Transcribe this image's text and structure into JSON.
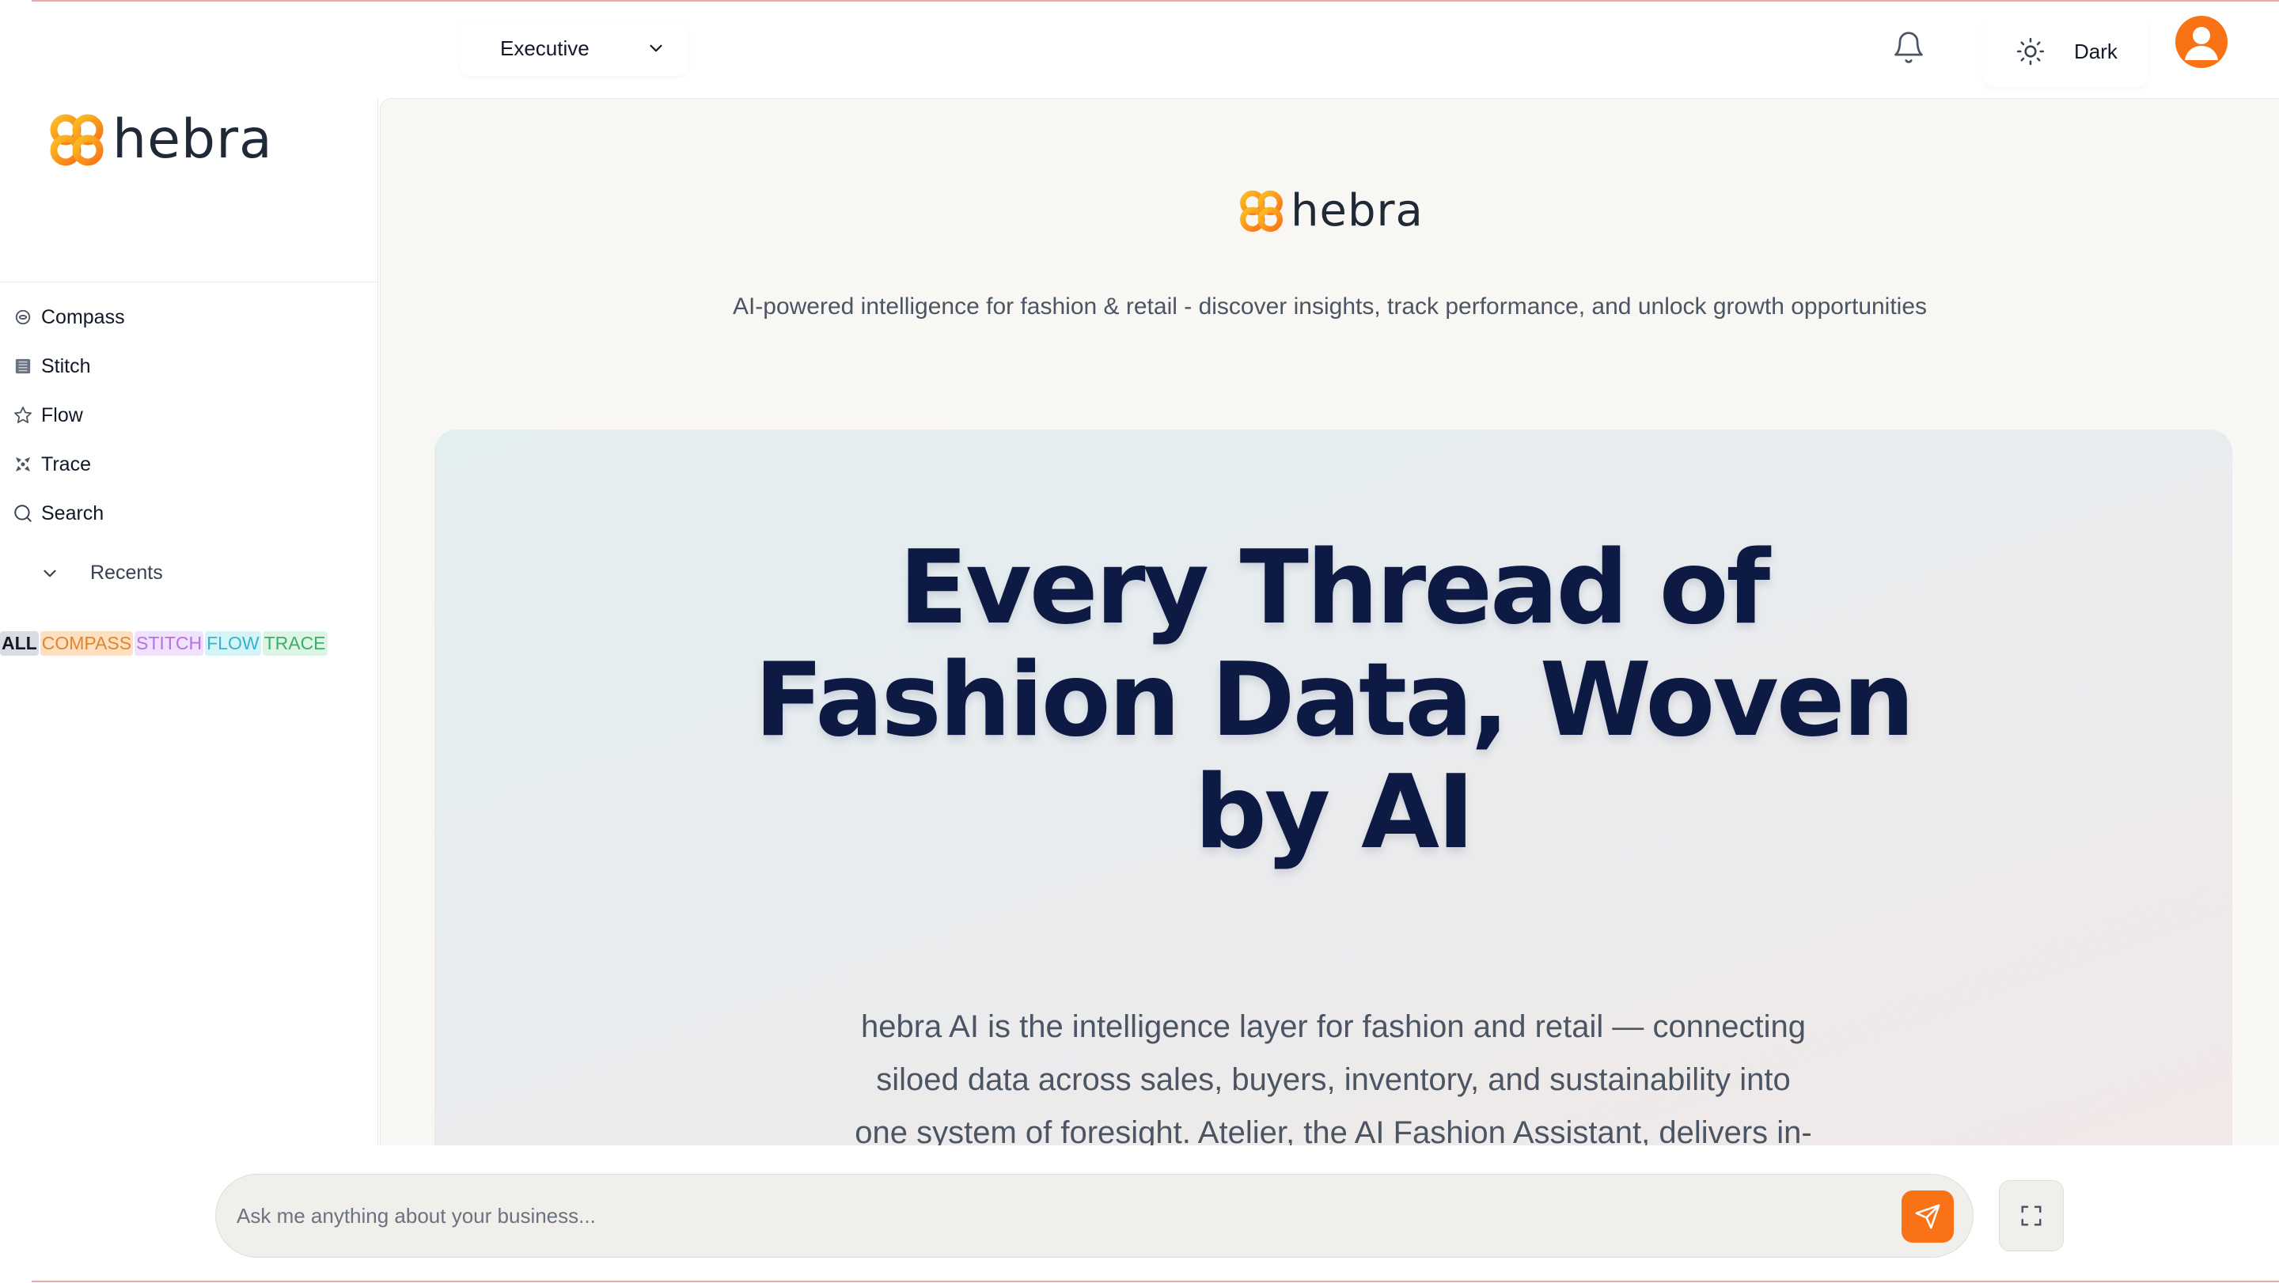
{
  "header": {
    "role_select": {
      "value": "Executive"
    },
    "theme_toggle_label": "Dark"
  },
  "brand": {
    "name": "hebra"
  },
  "sidebar": {
    "nav": [
      {
        "label": "Compass",
        "icon": "compass-icon"
      },
      {
        "label": "Stitch",
        "icon": "stitch-icon"
      },
      {
        "label": "Flow",
        "icon": "star-icon"
      },
      {
        "label": "Trace",
        "icon": "trace-icon"
      },
      {
        "label": "Search",
        "icon": "search-icon"
      }
    ],
    "recents_label": "Recents",
    "filters": [
      "ALL",
      "COMPASS",
      "STITCH",
      "FLOW",
      "TRACE"
    ]
  },
  "main": {
    "brand_name": "hebra",
    "tagline": "AI-powered intelligence for fashion & retail - discover insights, track performance, and unlock growth opportunities",
    "hero": {
      "title_lines": [
        "Every Thread of",
        "Fashion Data, Woven",
        "by AI"
      ],
      "description": "hebra AI is the intelligence layer for fashion and retail — connecting siloed data across sales, buyers, inventory, and sustainability into one system of foresight. Atelier, the AI Fashion Assistant, delivers in-context insights and strategies exactly when you need them."
    }
  },
  "chat": {
    "placeholder": "Ask me anything about your business..."
  },
  "colors": {
    "accent": "#f97316",
    "hero_title": "#0d1a44",
    "brand_mark_orange": "#f59e0b"
  }
}
